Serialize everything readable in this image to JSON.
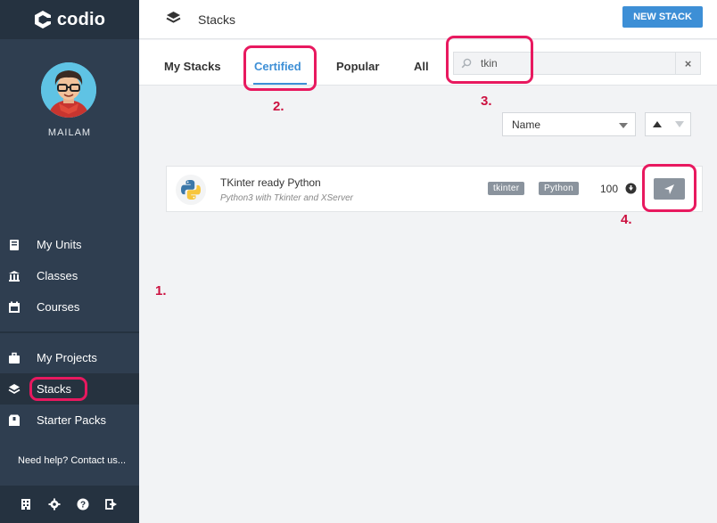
{
  "app": {
    "logo_text": "codio"
  },
  "user": {
    "name": "MAILAM"
  },
  "sidebar": {
    "items": [
      {
        "label": "My Units",
        "icon": "book-icon"
      },
      {
        "label": "Classes",
        "icon": "institution-icon"
      },
      {
        "label": "Courses",
        "icon": "calendar-icon"
      },
      {
        "label": "My Projects",
        "icon": "briefcase-icon"
      },
      {
        "label": "Stacks",
        "icon": "layers-icon",
        "active": true
      },
      {
        "label": "Starter Packs",
        "icon": "package-icon"
      }
    ],
    "help_text": "Need help? Contact us...",
    "footer_icons": [
      "building-icon",
      "gear-icon",
      "question-icon",
      "logout-icon"
    ]
  },
  "header": {
    "title": "Stacks",
    "new_button": "NEW STACK"
  },
  "tabs": [
    {
      "label": "My Stacks"
    },
    {
      "label": "Certified",
      "active": true
    },
    {
      "label": "Popular"
    },
    {
      "label": "All"
    }
  ],
  "search": {
    "value": "tkin",
    "clear": "×"
  },
  "sort": {
    "selected": "Name"
  },
  "stacks": [
    {
      "title": "TKinter ready Python",
      "subtitle": "Python3 with Tkinter and XServer",
      "tags": [
        "tkinter",
        "Python"
      ],
      "count": "100"
    }
  ],
  "annotations": [
    "1.",
    "2.",
    "3.",
    "4."
  ],
  "colors": {
    "accent": "#3d8fd6",
    "sidebar": "#2f3e50",
    "highlight": "#e8195f"
  }
}
